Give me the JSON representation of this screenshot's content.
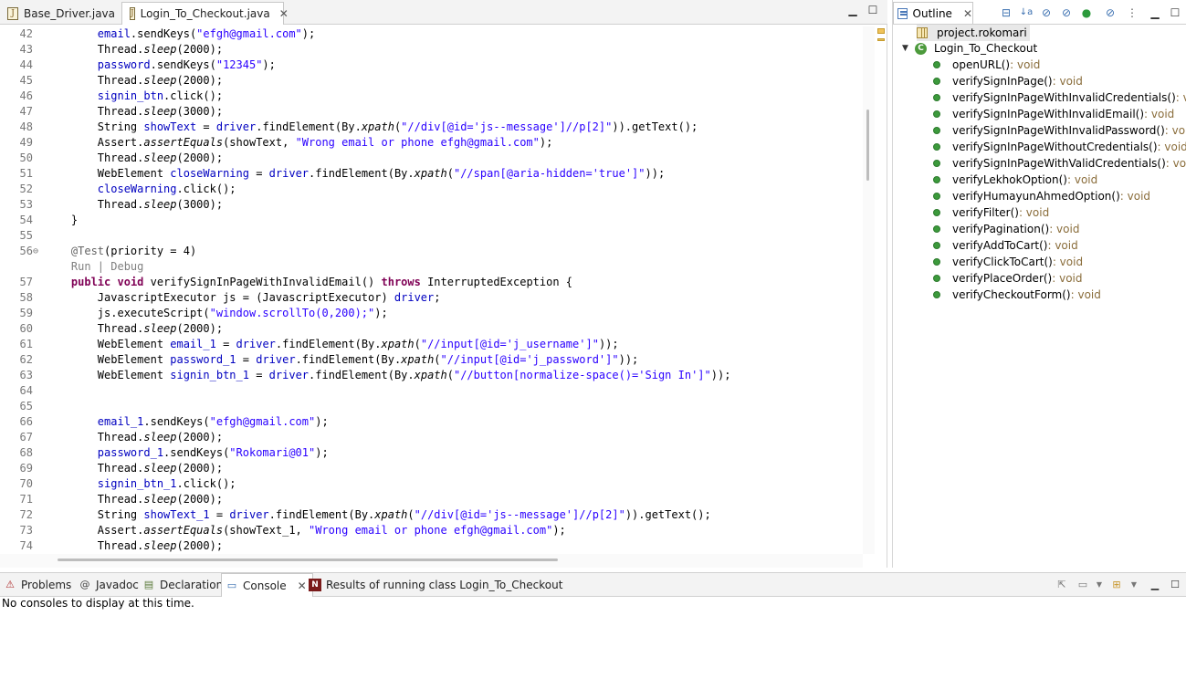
{
  "editor": {
    "tabs": [
      {
        "label": "Base_Driver.java",
        "active": false
      },
      {
        "label": "Login_To_Checkout.java",
        "active": true
      }
    ],
    "lines": [
      {
        "n": "42",
        "fold": "",
        "html": "        <span class=\"fld\">email</span>.sendKeys(<span class=\"str\">\"efgh@gmail.com\"</span>);"
      },
      {
        "n": "43",
        "fold": "",
        "html": "        Thread.<span class=\"it\">sleep</span>(2000);"
      },
      {
        "n": "44",
        "fold": "",
        "html": "        <span class=\"fld\">password</span>.sendKeys(<span class=\"str\">\"12345\"</span>);"
      },
      {
        "n": "45",
        "fold": "",
        "html": "        Thread.<span class=\"it\">sleep</span>(2000);"
      },
      {
        "n": "46",
        "fold": "",
        "html": "        <span class=\"fld\">signin_btn</span>.click();"
      },
      {
        "n": "47",
        "fold": "",
        "html": "        Thread.<span class=\"it\">sleep</span>(3000);"
      },
      {
        "n": "48",
        "fold": "",
        "html": "        String <span class=\"fld\">showText</span> = <span class=\"fld\">driver</span>.findElement(By.<span class=\"it\">xpath</span>(<span class=\"str\">\"//div[@id='js--message']//p[2]\"</span>)).getText();"
      },
      {
        "n": "49",
        "fold": "",
        "html": "        Assert.<span class=\"it\">assertEquals</span>(showText, <span class=\"str\">\"Wrong email or phone efgh@gmail.com\"</span>);"
      },
      {
        "n": "50",
        "fold": "",
        "html": "        Thread.<span class=\"it\">sleep</span>(2000);"
      },
      {
        "n": "51",
        "fold": "",
        "html": "        WebElement <span class=\"fld\">closeWarning</span> = <span class=\"fld\">driver</span>.findElement(By.<span class=\"it\">xpath</span>(<span class=\"str\">\"//span[@aria-hidden='true']\"</span>));"
      },
      {
        "n": "52",
        "fold": "",
        "html": "        <span class=\"fld\">closeWarning</span>.click();"
      },
      {
        "n": "53",
        "fold": "",
        "html": "        Thread.<span class=\"it\">sleep</span>(3000);"
      },
      {
        "n": "54",
        "fold": "",
        "html": "    }"
      },
      {
        "n": "55",
        "fold": "",
        "html": ""
      },
      {
        "n": "56",
        "fold": "⊖",
        "html": "    <span class=\"ann\">@Test</span>(priority = 4)"
      },
      {
        "n": "",
        "fold": "",
        "html": "    <span class=\"lens\">Run | Debug</span>"
      },
      {
        "n": "57",
        "fold": "",
        "html": "    <span class=\"kw\">public</span> <span class=\"kw\">void</span> verifySignInPageWithInvalidEmail() <span class=\"kw\">throws</span> InterruptedException {"
      },
      {
        "n": "58",
        "fold": "",
        "html": "        JavascriptExecutor js = (JavascriptExecutor) <span class=\"fld\">driver</span>;"
      },
      {
        "n": "59",
        "fold": "",
        "html": "        js.executeScript(<span class=\"str\">\"window.scrollTo(0,200);\"</span>);"
      },
      {
        "n": "60",
        "fold": "",
        "html": "        Thread.<span class=\"it\">sleep</span>(2000);"
      },
      {
        "n": "61",
        "fold": "",
        "html": "        WebElement <span class=\"fld\">email_1</span> = <span class=\"fld\">driver</span>.findElement(By.<span class=\"it\">xpath</span>(<span class=\"str\">\"//input[@id='j_username']\"</span>));"
      },
      {
        "n": "62",
        "fold": "",
        "html": "        WebElement <span class=\"fld\">password_1</span> = <span class=\"fld\">driver</span>.findElement(By.<span class=\"it\">xpath</span>(<span class=\"str\">\"//input[@id='j_password']\"</span>));"
      },
      {
        "n": "63",
        "fold": "",
        "html": "        WebElement <span class=\"fld\">signin_btn_1</span> = <span class=\"fld\">driver</span>.findElement(By.<span class=\"it\">xpath</span>(<span class=\"str\">\"//button[normalize-space()='Sign In']\"</span>));"
      },
      {
        "n": "64",
        "fold": "",
        "html": ""
      },
      {
        "n": "65",
        "fold": "",
        "html": ""
      },
      {
        "n": "66",
        "fold": "",
        "html": "        <span class=\"fld\">email_1</span>.sendKeys(<span class=\"str\">\"efgh@gmail.com\"</span>);"
      },
      {
        "n": "67",
        "fold": "",
        "html": "        Thread.<span class=\"it\">sleep</span>(2000);"
      },
      {
        "n": "68",
        "fold": "",
        "html": "        <span class=\"fld\">password_1</span>.sendKeys(<span class=\"str\">\"Rokomari@01\"</span>);"
      },
      {
        "n": "69",
        "fold": "",
        "html": "        Thread.<span class=\"it\">sleep</span>(2000);"
      },
      {
        "n": "70",
        "fold": "",
        "html": "        <span class=\"fld\">signin_btn_1</span>.click();"
      },
      {
        "n": "71",
        "fold": "",
        "html": "        Thread.<span class=\"it\">sleep</span>(2000);"
      },
      {
        "n": "72",
        "fold": "",
        "html": "        String <span class=\"fld\">showText_1</span> = <span class=\"fld\">driver</span>.findElement(By.<span class=\"it\">xpath</span>(<span class=\"str\">\"//div[@id='js--message']//p[2]\"</span>)).getText();"
      },
      {
        "n": "73",
        "fold": "",
        "html": "        Assert.<span class=\"it\">assertEquals</span>(showText_1, <span class=\"str\">\"Wrong email or phone efgh@gmail.com\"</span>);"
      },
      {
        "n": "74",
        "fold": "",
        "html": "        Thread.<span class=\"it\">sleep</span>(2000);"
      }
    ]
  },
  "outline": {
    "title": "Outline",
    "package": "project.rokomari",
    "class_name": "Login_To_Checkout",
    "class_icon": "C",
    "methods": [
      {
        "name": "openURL()",
        "type": " : void"
      },
      {
        "name": "verifySignInPage()",
        "type": " : void"
      },
      {
        "name": "verifySignInPageWithInvalidCredentials()",
        "type": " : void"
      },
      {
        "name": "verifySignInPageWithInvalidEmail()",
        "type": " : void"
      },
      {
        "name": "verifySignInPageWithInvalidPassword()",
        "type": " : void"
      },
      {
        "name": "verifySignInPageWithoutCredentials()",
        "type": " : void"
      },
      {
        "name": "verifySignInPageWithValidCredentials()",
        "type": " : void"
      },
      {
        "name": "verifyLekhokOption()",
        "type": " : void"
      },
      {
        "name": "verifyHumayunAhmedOption()",
        "type": " : void"
      },
      {
        "name": "verifyFilter()",
        "type": " : void"
      },
      {
        "name": "verifyPagination()",
        "type": " : void"
      },
      {
        "name": "verifyAddToCart()",
        "type": " : void"
      },
      {
        "name": "verifyClickToCart()",
        "type": " : void"
      },
      {
        "name": "verifyPlaceOrder()",
        "type": " : void"
      },
      {
        "name": "verifyCheckoutForm()",
        "type": " : void"
      }
    ]
  },
  "bottom": {
    "tabs": [
      {
        "label": "Problems",
        "icon": "problems-icon"
      },
      {
        "label": "Javadoc",
        "icon": "javadoc-icon"
      },
      {
        "label": "Declaration",
        "icon": "declaration-icon"
      },
      {
        "label": "Console",
        "icon": "console-icon",
        "active": true
      },
      {
        "label": "Results of running class Login_To_Checkout",
        "icon": "testng-icon"
      }
    ],
    "message": "No consoles to display at this time."
  }
}
